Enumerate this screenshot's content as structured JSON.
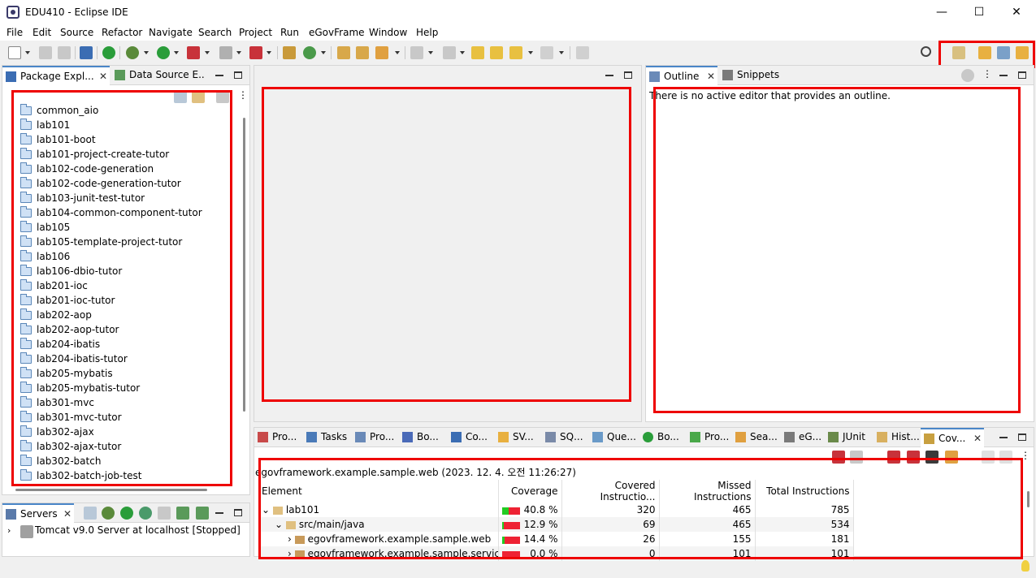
{
  "window": {
    "title": "EDU410 - Eclipse IDE",
    "min": "—",
    "max": "☐",
    "close": "✕"
  },
  "menu": [
    "File",
    "Edit",
    "Source",
    "Refactor",
    "Navigate",
    "Search",
    "Project",
    "Run",
    "eGovFrame",
    "Window",
    "Help"
  ],
  "package_explorer": {
    "tabs": [
      {
        "label": "Package Expl..."
      },
      {
        "label": "Data Source E..."
      }
    ],
    "items": [
      "common_aio",
      "lab101",
      "lab101-boot",
      "lab101-project-create-tutor",
      "lab102-code-generation",
      "lab102-code-generation-tutor",
      "lab103-junit-test-tutor",
      "lab104-common-component-tutor",
      "lab105",
      "lab105-template-project-tutor",
      "lab106",
      "lab106-dbio-tutor",
      "lab201-ioc",
      "lab201-ioc-tutor",
      "lab202-aop",
      "lab202-aop-tutor",
      "lab204-ibatis",
      "lab204-ibatis-tutor",
      "lab205-mybatis",
      "lab205-mybatis-tutor",
      "lab301-mvc",
      "lab301-mvc-tutor",
      "lab302-ajax",
      "lab302-ajax-tutor",
      "lab302-batch",
      "lab302-batch-job-test"
    ]
  },
  "servers": {
    "tab": "Servers",
    "item": "Tomcat v9.0 Server at localhost  [Stopped]"
  },
  "outline": {
    "tabs": [
      {
        "label": "Outline"
      },
      {
        "label": "Snippets"
      }
    ],
    "message": "There is no active editor that provides an outline."
  },
  "bottom_tabs": [
    "Pro...",
    "Tasks",
    "Pro...",
    "Bo...",
    "Co...",
    "SV...",
    "SQ...",
    "Que...",
    "Bo...",
    "Pro...",
    "Sea...",
    "eG...",
    "JUnit",
    "Hist...",
    "Cov..."
  ],
  "coverage": {
    "session": "egovframework.example.sample.web (2023. 12. 4. 오전 11:26:27)",
    "columns": [
      "Element",
      "Coverage",
      "Covered Instructio...",
      "Missed Instructions",
      "Total Instructions"
    ],
    "rows": [
      {
        "element": "lab101",
        "coverage": "40.8 %",
        "covered": "320",
        "missed": "465",
        "total": "785",
        "ratio": 0.408
      },
      {
        "element": "src/main/java",
        "coverage": "12.9 %",
        "covered": "69",
        "missed": "465",
        "total": "534",
        "ratio": 0.129
      },
      {
        "element": "egovframework.example.sample.web",
        "coverage": "14.4 %",
        "covered": "26",
        "missed": "155",
        "total": "181",
        "ratio": 0.144
      },
      {
        "element": "egovframework.example.sample.service.im",
        "coverage": "0.0 %",
        "covered": "0",
        "missed": "101",
        "total": "101",
        "ratio": 0.0
      }
    ]
  },
  "colors": {
    "highlight": "#ee0000",
    "accent": "#4a86c8",
    "covered": "#22cc22",
    "missed": "#ee2233"
  }
}
